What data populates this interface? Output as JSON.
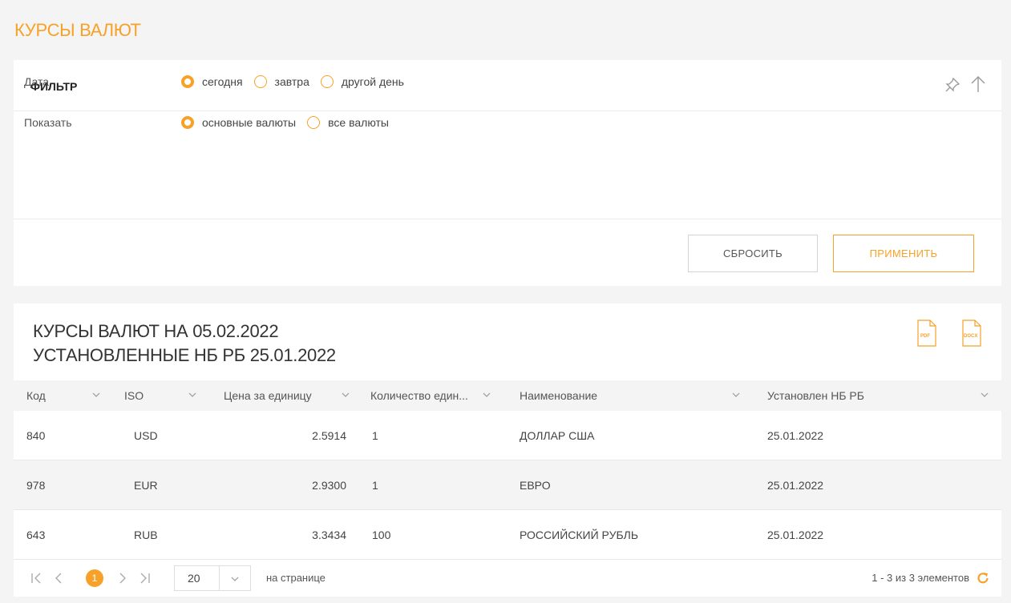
{
  "page": {
    "title": "КУРСЫ ВАЛЮТ"
  },
  "filter": {
    "title": "ФИЛЬТР",
    "date_label": "Дата",
    "date_options": [
      "сегодня",
      "завтра",
      "другой день"
    ],
    "date_selected": "сегодня",
    "show_label": "Показать",
    "show_options": [
      "основные валюты",
      "все валюты"
    ],
    "show_selected": "основные валюты",
    "reset_label": "СБРОСИТЬ",
    "apply_label": "ПРИМЕНИТЬ"
  },
  "rates": {
    "title_line1": "КУРСЫ ВАЛЮТ НА 05.02.2022",
    "title_line2": "УСТАНОВЛЕННЫЕ НБ РБ 25.01.2022",
    "export_icons": [
      "pdf-icon",
      "docx-icon"
    ],
    "columns": [
      "Код",
      "ISO",
      "Цена за единицу",
      "Количество един...",
      "Наименование",
      "Установлен НБ РБ"
    ],
    "rows": [
      {
        "code": "840",
        "iso": "USD",
        "price": "2.5914",
        "qty": "1",
        "name": "ДОЛЛАР США",
        "set": "25.01.2022"
      },
      {
        "code": "978",
        "iso": "EUR",
        "price": "2.9300",
        "qty": "1",
        "name": "ЕВРО",
        "set": "25.01.2022"
      },
      {
        "code": "643",
        "iso": "RUB",
        "price": "3.3434",
        "qty": "100",
        "name": "РОССИЙСКИЙ РУБЛЬ",
        "set": "25.01.2022"
      }
    ]
  },
  "pager": {
    "current_page": "1",
    "page_size": "20",
    "per_page_label": "на странице",
    "range_text": "1 - 3 из 3 элементов"
  },
  "colors": {
    "accent": "#f7a128",
    "background": "#f4f4f4",
    "panel": "#ffffff"
  }
}
